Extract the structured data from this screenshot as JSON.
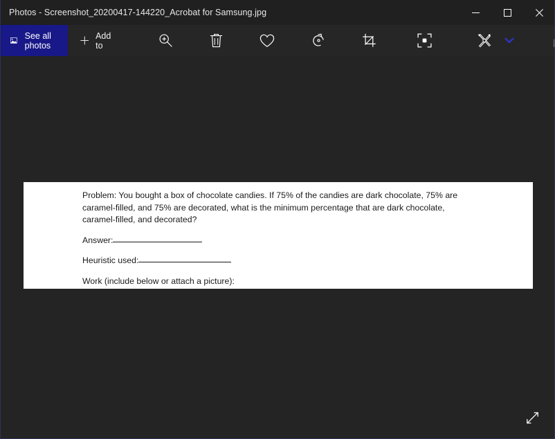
{
  "window": {
    "title": "Photos - Screenshot_20200417-144220_Acrobat for Samsung.jpg",
    "minimize_label": "Minimize",
    "maximize_label": "Maximize",
    "close_label": "Close"
  },
  "command_bar": {
    "see_all_photos_label": "See all photos",
    "add_to_label": "Add to",
    "icons": [
      {
        "name": "zoom-in-icon",
        "label": "Zoom"
      },
      {
        "name": "delete-icon",
        "label": "Delete"
      },
      {
        "name": "favorite-icon",
        "label": "Add to favorites"
      },
      {
        "name": "rotate-icon",
        "label": "Rotate"
      },
      {
        "name": "crop-icon",
        "label": "Crop and rotate"
      },
      {
        "name": "enhance-icon",
        "label": "Enhance your photo"
      },
      {
        "name": "edit-creative-icon",
        "label": "Edit & Create"
      },
      {
        "name": "share-icon",
        "label": "Share"
      }
    ],
    "edit_chevron": "⌄",
    "ellipsis_label": "···",
    "accent_blue": "#181888",
    "chevron_blue": "#2c35c4"
  },
  "viewer": {
    "fullscreen_label": "Enter fullscreen",
    "background_color": "#242424"
  },
  "document": {
    "problem": "Problem: You bought a box of chocolate candies.  If 75% of the candies are dark chocolate, 75% are caramel-filled, and 75% are decorated, what is the minimum percentage that are dark chocolate, caramel-filled, and decorated?",
    "answer_label": "Answer:",
    "heuristic_label": "Heuristic used:",
    "work_label": "Work (include below or attach a picture):"
  }
}
